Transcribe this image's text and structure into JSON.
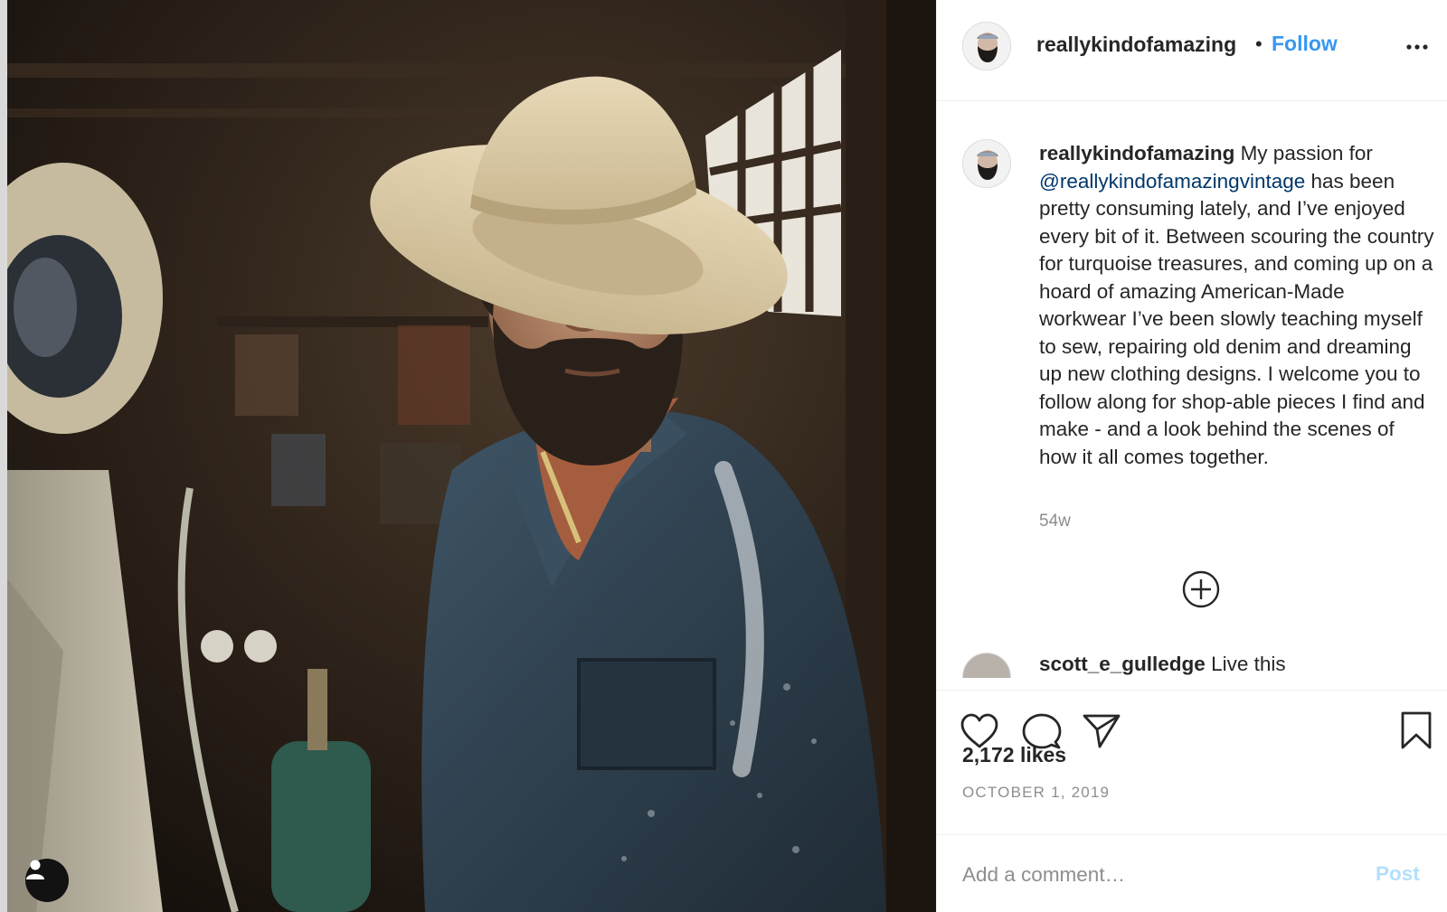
{
  "post": {
    "image_alt": "Portrait of a bearded man in a straw hat and worn denim jacket in a workshop",
    "tag_icon": "user-tag-icon"
  },
  "header": {
    "username": "reallykindofamazing",
    "separator": "•",
    "follow_label": "Follow",
    "more_icon": "more-options-icon"
  },
  "caption": {
    "username": "reallykindofamazing",
    "text_before": " My passion for ",
    "mention": "@reallykindofamazingvintage",
    "text_after": " has been pretty consuming lately, and I’ve enjoyed every bit of it. Between scouring the country for turquoise treasures, and coming up on a hoard of amazing American-Made workwear I’ve been slowly teaching myself to sew, repairing old denim and dreaming up new clothing designs. I welcome you to follow along for shop-able pieces I find and make - and a look behind the scenes of how it all comes together.",
    "age": "54w"
  },
  "next_comment": {
    "username": "scott_e_gulledge",
    "text": " Live this"
  },
  "actions": {
    "like_icon": "heart-icon",
    "comment_icon": "comment-bubble-icon",
    "share_icon": "paper-plane-icon",
    "save_icon": "bookmark-icon"
  },
  "stats": {
    "likes": "2,172 likes",
    "date": "OCTOBER 1, 2019"
  },
  "comment_box": {
    "placeholder": "Add a comment…",
    "post_label": "Post"
  },
  "colors": {
    "link_blue": "#3897f0",
    "mention_blue": "#00376b",
    "post_disabled": "#b2dffc",
    "muted": "#8e8e8e"
  }
}
